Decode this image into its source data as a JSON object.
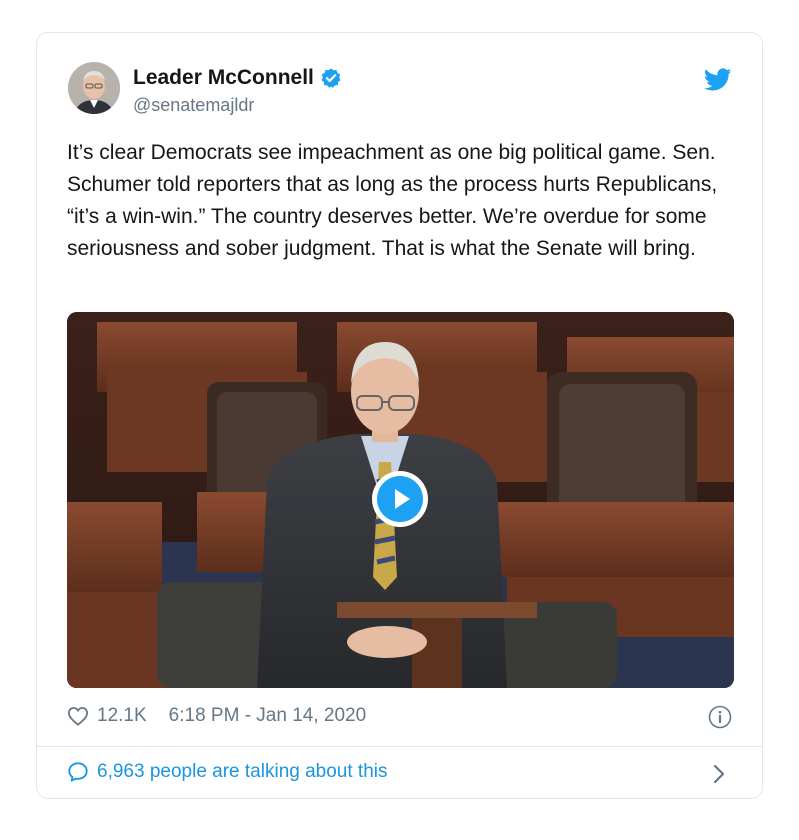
{
  "author": {
    "name": "Leader McConnell",
    "handle": "@senatemajldr"
  },
  "tweet": {
    "text": "It’s clear Democrats see impeachment as one big political game. Sen. Schumer told reporters that as long as the process hurts Republicans, “it’s a win-win.” The country deserves better. We’re overdue for some seriousness and sober judgment. That is what the Senate will bring.",
    "likes": "12.1K",
    "timestamp": "6:18 PM - Jan 14, 2020"
  },
  "footer": {
    "talking": "6,963 people are talking about this"
  },
  "icons": {
    "verified": "verified-badge-icon",
    "brand": "twitter-bird-icon",
    "like": "heart-icon",
    "info": "info-icon",
    "reply": "chat-bubble-icon",
    "more": "chevron-right-icon",
    "video": "play-icon"
  },
  "colors": {
    "accent": "#1da1f2",
    "link": "#1b95e0",
    "text": "#14171a",
    "muted": "#657786"
  }
}
